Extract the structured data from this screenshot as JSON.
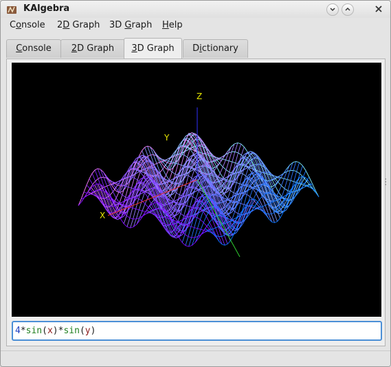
{
  "window": {
    "title": "KAlgebra"
  },
  "menubar": {
    "items": [
      {
        "label": "Console",
        "mnemonic": "o"
      },
      {
        "label": "2D Graph",
        "mnemonic": "D"
      },
      {
        "label": "3D Graph",
        "mnemonic": "G"
      },
      {
        "label": "Help",
        "mnemonic": "H"
      }
    ]
  },
  "tabs": [
    {
      "label": "Console",
      "active": false
    },
    {
      "label": "2D Graph",
      "active": false
    },
    {
      "label": "3D Graph",
      "active": true
    },
    {
      "label": "Dictionary",
      "active": false
    }
  ],
  "graph3d": {
    "background": "#000000",
    "axis_labels": {
      "x": "X",
      "y": "Y",
      "z": "Z"
    },
    "axis_colors": {
      "x": "#e03030",
      "y": "#30d030",
      "z": "#3030ff"
    },
    "label_color": "#e6e600",
    "surface_colors": [
      "#ffffff",
      "#00e5ff",
      "#ff00ff",
      "#0000ff"
    ]
  },
  "expression": {
    "tokens": [
      {
        "text": "4",
        "color": "#2040c0"
      },
      {
        "text": "*",
        "color": "#202020"
      },
      {
        "text": "sin",
        "color": "#208020"
      },
      {
        "text": "(",
        "color": "#202020"
      },
      {
        "text": "x",
        "color": "#8b1a1a"
      },
      {
        "text": ")",
        "color": "#202020"
      },
      {
        "text": "*",
        "color": "#202020"
      },
      {
        "text": "sin",
        "color": "#208020"
      },
      {
        "text": "(",
        "color": "#202020"
      },
      {
        "text": "y",
        "color": "#8b1a1a"
      },
      {
        "text": ")",
        "color": "#202020"
      }
    ]
  },
  "icons": {
    "app": "kalgebra-app-icon",
    "minimize": "chevron-down-icon",
    "maximize": "chevron-up-icon",
    "close": "close-icon"
  }
}
